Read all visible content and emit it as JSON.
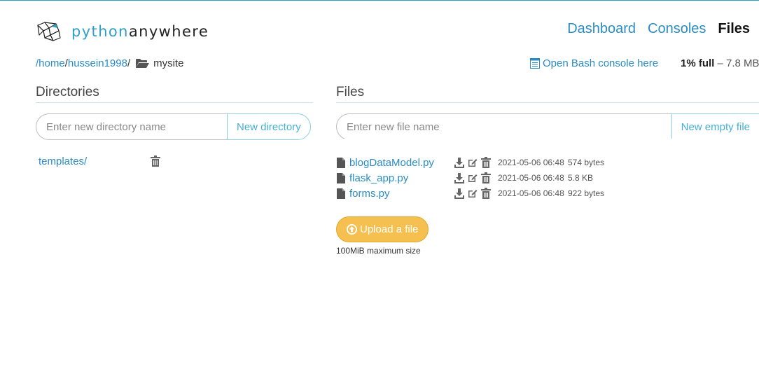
{
  "brand": {
    "python": "python",
    "anywhere": "anywhere",
    "logo_icon": "pythonanywhere-logo-icon"
  },
  "nav": [
    {
      "label": "Dashboard",
      "active": false
    },
    {
      "label": "Consoles",
      "active": false
    },
    {
      "label": "Files",
      "active": true
    }
  ],
  "breadcrumb": {
    "home": "/home",
    "sep1": "/",
    "user": "hussein1998",
    "sep2": "/",
    "current": "mysite",
    "folder_icon": "folder-open-icon"
  },
  "bash_console": {
    "label": "Open Bash console here",
    "icon": "console-icon"
  },
  "usage": {
    "percent": "1% full",
    "dash": "–",
    "amount": "7.8 MB"
  },
  "directories": {
    "title": "Directories",
    "input_placeholder": "Enter new directory name",
    "button_label": "New directory",
    "items": [
      {
        "name": "templates/"
      }
    ]
  },
  "files": {
    "title": "Files",
    "input_placeholder": "Enter new file name",
    "button_label": "New empty file",
    "items": [
      {
        "name": "blogDataModel.py",
        "date": "2021-05-06 06:48",
        "size": "574 bytes"
      },
      {
        "name": "flask_app.py",
        "date": "2021-05-06 06:48",
        "size": "5.8 KB"
      },
      {
        "name": "forms.py",
        "date": "2021-05-06 06:48",
        "size": "922 bytes"
      }
    ]
  },
  "upload": {
    "label": "Upload a file",
    "max_size": "100MiB maximum size",
    "icon": "upload-circle-icon"
  },
  "colors": {
    "link": "#2a8cc4",
    "accent": "#2f9fc9",
    "upload": "#f5c04f"
  }
}
